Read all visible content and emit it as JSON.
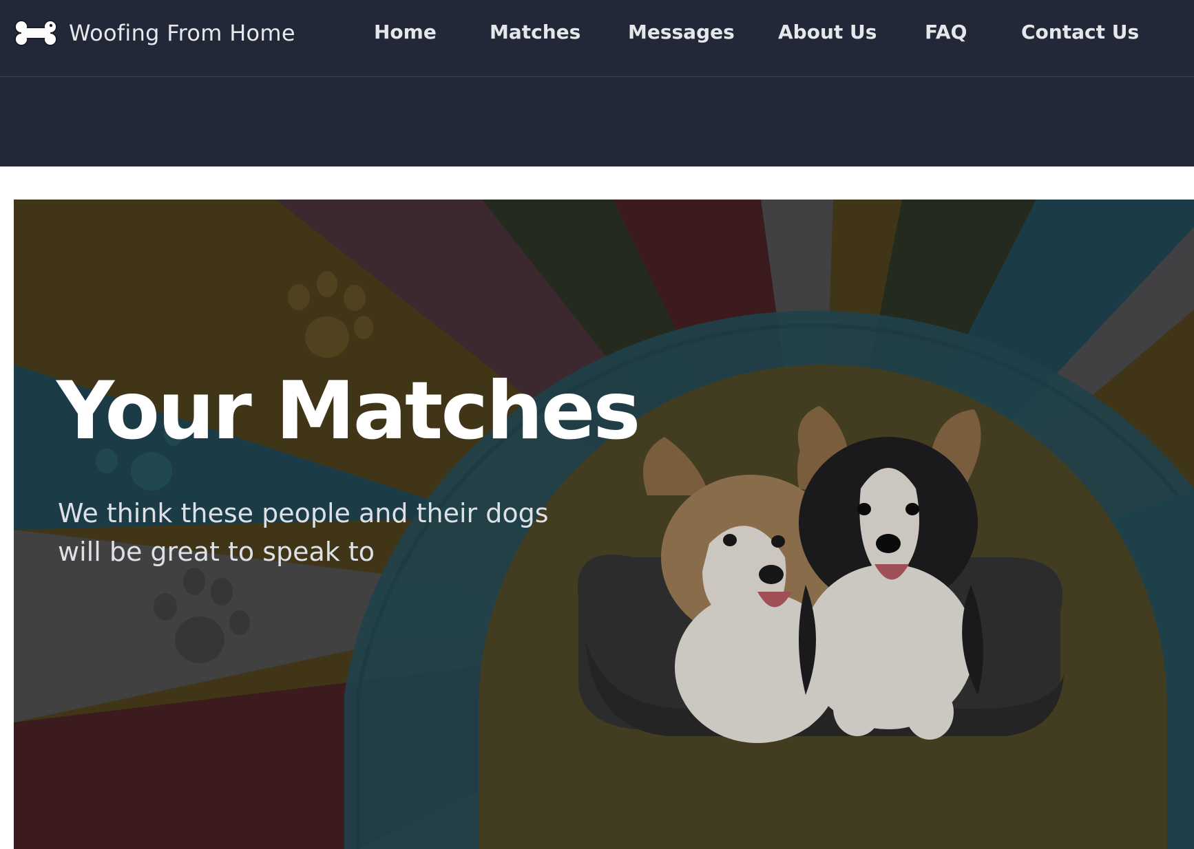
{
  "brand": {
    "name": "Woofing From Home",
    "icon": "bone-icon"
  },
  "nav": {
    "items": [
      {
        "label": "Home"
      },
      {
        "label": "Matches"
      },
      {
        "label": "Messages"
      },
      {
        "label": "About Us"
      },
      {
        "label": "FAQ"
      },
      {
        "label": "Contact Us"
      }
    ]
  },
  "hero": {
    "title": "Your Matches",
    "subtitle_line1": "We think these people and their dogs",
    "subtitle_line2": "will be great to speak to",
    "image": "two-corgi-puppies-in-dog-bed"
  },
  "colors": {
    "header_bg": "#222838",
    "hero_overlay_mustard": "#4a3d1c",
    "hero_teal": "#1f4450",
    "hero_red": "#451f20",
    "hero_grey": "#4a4a4c",
    "hero_arch": "#4c4626"
  }
}
